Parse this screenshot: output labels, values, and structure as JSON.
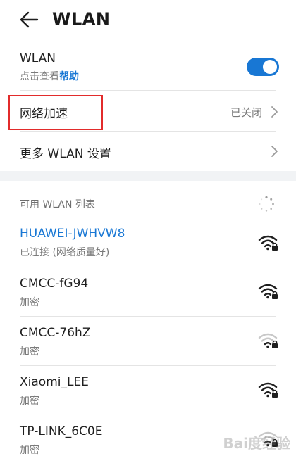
{
  "header": {
    "title": "WLAN"
  },
  "wlan_toggle": {
    "label": "WLAN",
    "help_prefix": "点击查看",
    "help_link": "帮助",
    "enabled": true
  },
  "acceleration": {
    "label": "网络加速",
    "value": "已关闭"
  },
  "more_settings": {
    "label": "更多 WLAN 设置"
  },
  "available_list": {
    "header": "可用 WLAN 列表"
  },
  "networks": [
    {
      "name": "HUAWEI-JWHVW8",
      "status": "已连接 (网络质量好)",
      "connected": true,
      "signal": "full"
    },
    {
      "name": "CMCC-fG94",
      "status": "加密",
      "connected": false,
      "signal": "full"
    },
    {
      "name": "CMCC-76hZ",
      "status": "加密",
      "connected": false,
      "signal": "weak"
    },
    {
      "name": "Xiaomi_LEE",
      "status": "加密",
      "connected": false,
      "signal": "full"
    },
    {
      "name": "TP-LINK_6C0E",
      "status": "加密",
      "connected": false,
      "signal": "weak"
    }
  ],
  "colors": {
    "accent": "#1877d4",
    "highlight": "#e22b2b"
  },
  "watermark": "Bai度经验"
}
